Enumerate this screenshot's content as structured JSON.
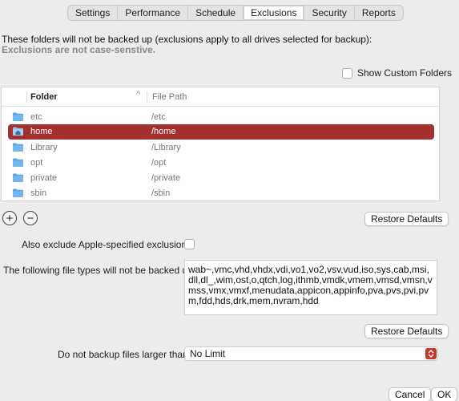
{
  "tabs": [
    "Settings",
    "Performance",
    "Schedule",
    "Exclusions",
    "Security",
    "Reports"
  ],
  "active_tab": "Exclusions",
  "intro": {
    "line1": "These folders will not be backed up (exclusions apply to all drives selected for backup):",
    "line2": "Exclusions are not case-senstive."
  },
  "show_custom_folders": {
    "label": "Show Custom Folders",
    "checked": false
  },
  "table": {
    "columns": [
      "Folder",
      "File Path"
    ],
    "sort_indicator": "^",
    "rows": [
      {
        "folder": "etc",
        "path": "/etc",
        "selected": false
      },
      {
        "folder": "home",
        "path": "/home",
        "selected": true
      },
      {
        "folder": "Library",
        "path": "/Library",
        "selected": false
      },
      {
        "folder": "opt",
        "path": "/opt",
        "selected": false
      },
      {
        "folder": "private",
        "path": "/private",
        "selected": false
      },
      {
        "folder": "sbin",
        "path": "/sbin",
        "selected": false
      }
    ]
  },
  "add_button": "+",
  "remove_button": "−",
  "restore_defaults_label": "Restore Defaults",
  "apple_exclusions": {
    "label": "Also exclude Apple-specified exclusions:",
    "checked": false
  },
  "file_types": {
    "label": "The following file types will not be backed up:",
    "value": "wab~,vmc,vhd,vhdx,vdi,vo1,vo2,vsv,vud,iso,sys,cab,msi,dll,dl_,wim,ost,o,qtch,log,ithmb,vmdk,vmem,vmsd,vmsn,vmss,vmx,vmxf,menudata,appicon,appinfo,pva,pvs,pvi,pvm,fdd,hds,drk,mem,nvram,hdd"
  },
  "size_limit": {
    "label": "Do not backup files larger than:",
    "value": "No Limit"
  },
  "footer": {
    "cancel": "Cancel",
    "ok": "OK"
  },
  "colors": {
    "selection": "#a3302c",
    "folder_icon": "#5ba4e5",
    "accent": "#c0392b"
  },
  "icons": {
    "folder": "folder-icon",
    "home_folder": "home-folder-icon",
    "select_arrows": "chevron-up-down-icon"
  }
}
